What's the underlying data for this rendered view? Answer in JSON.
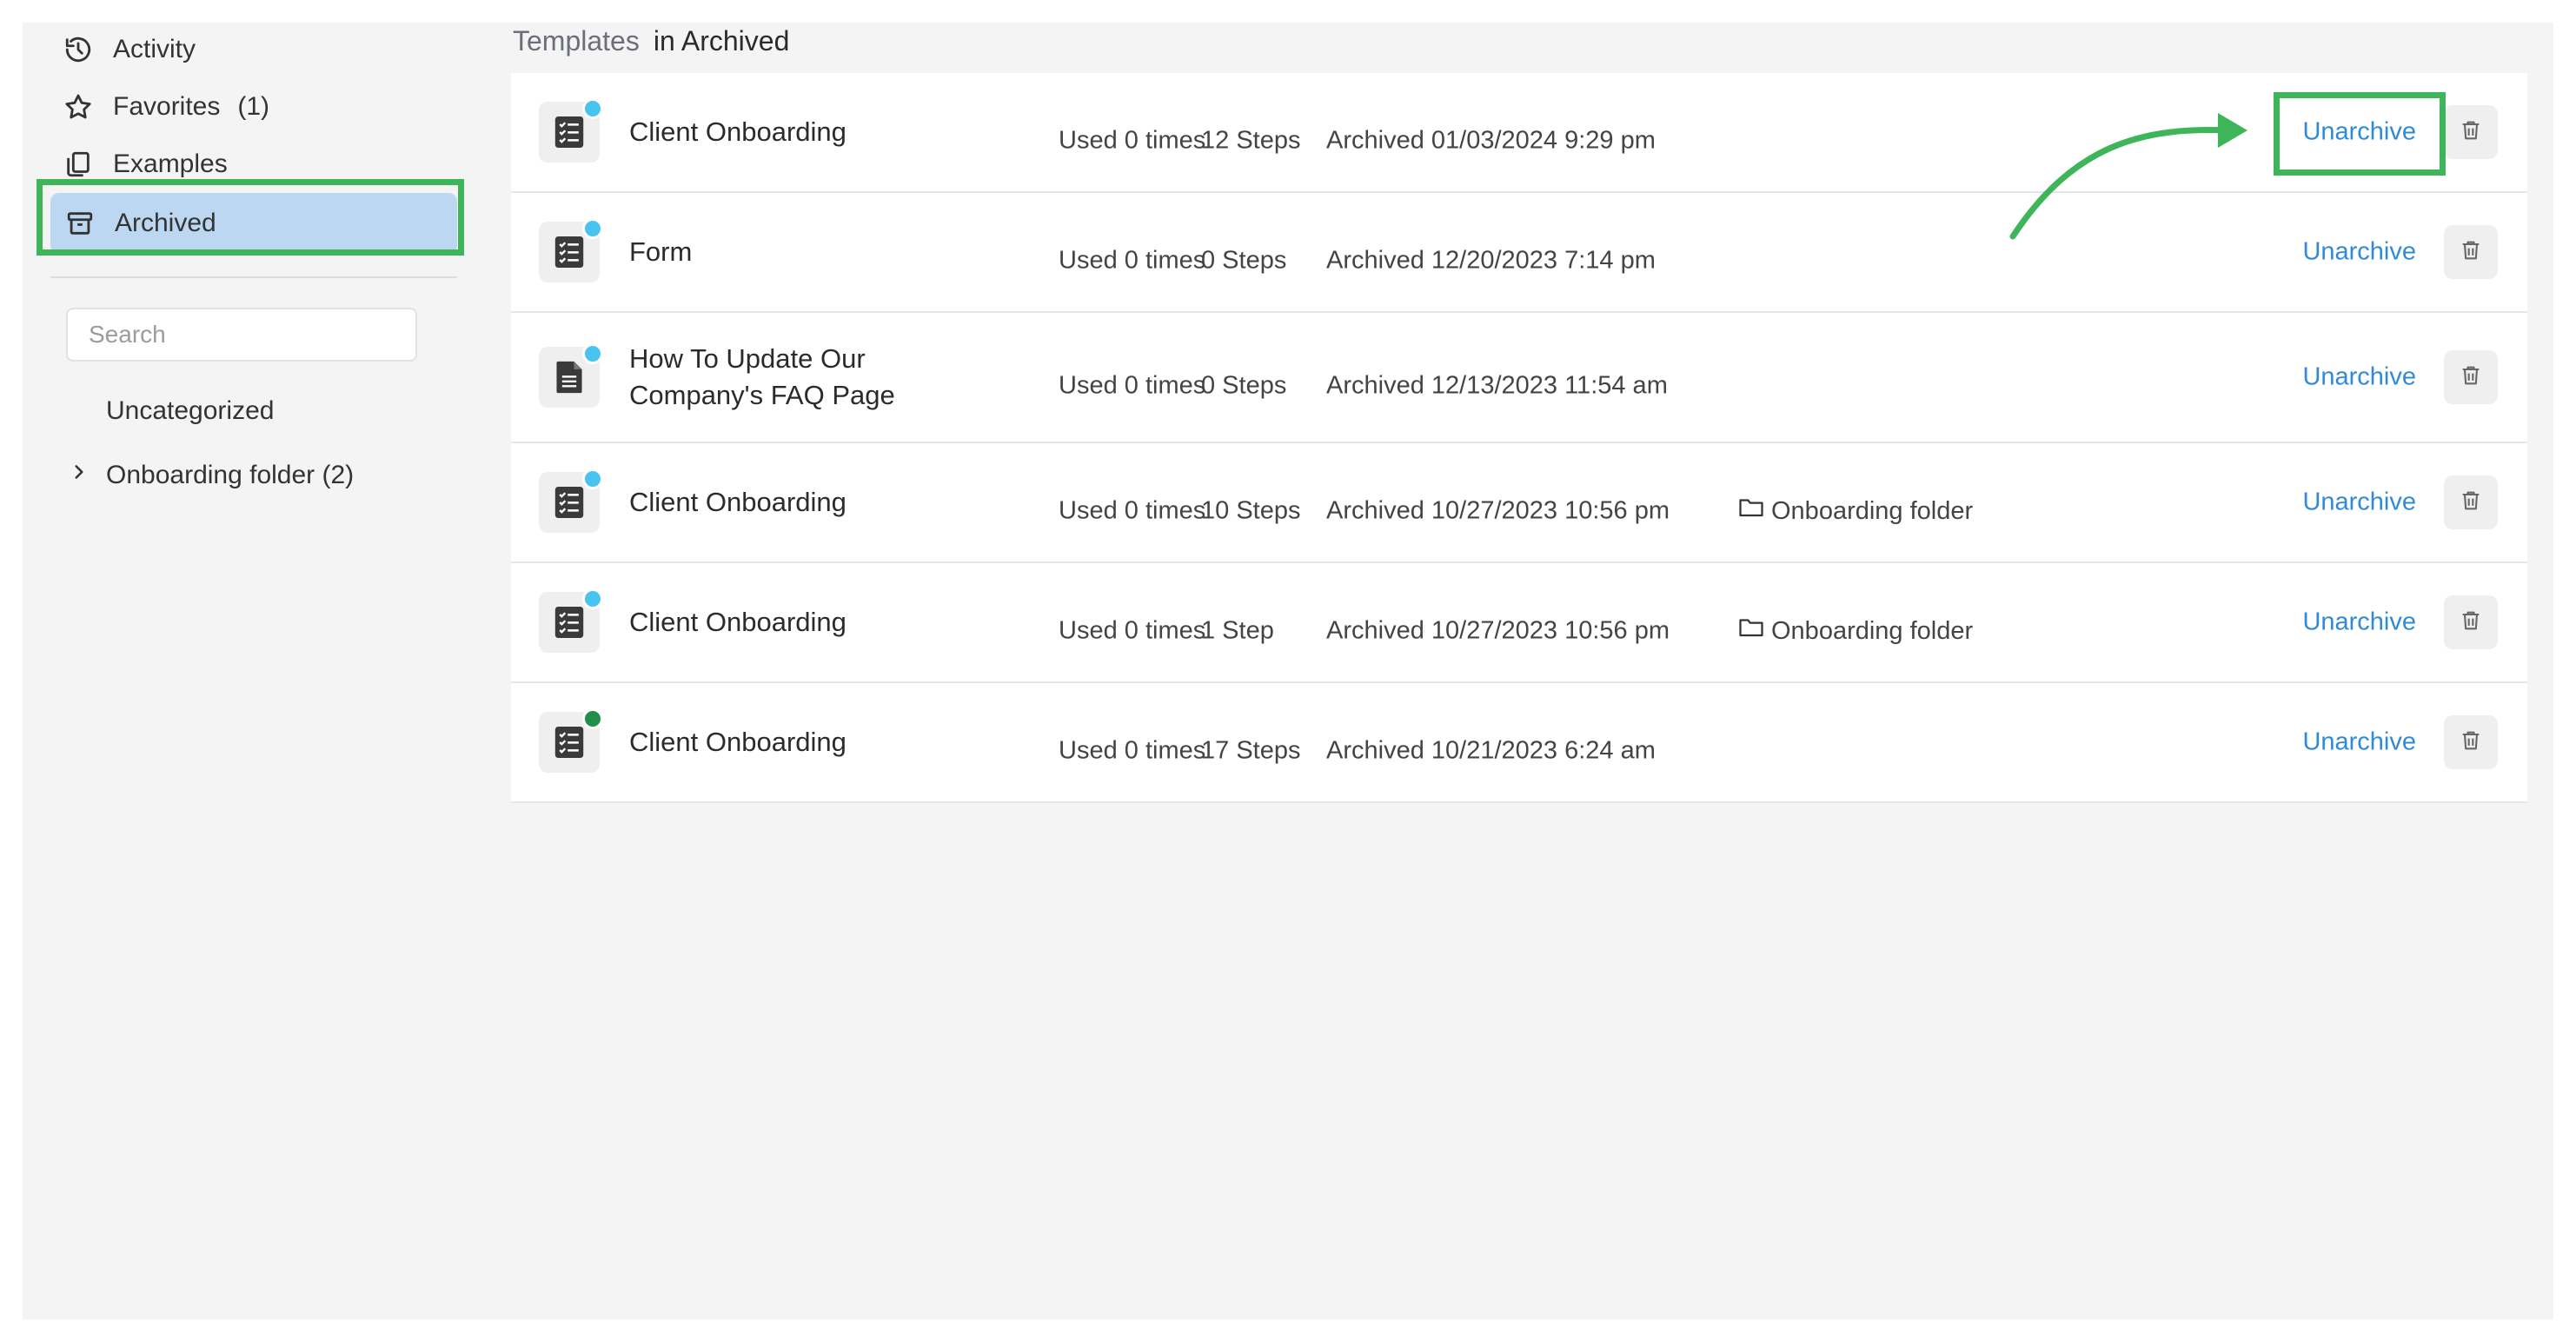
{
  "sidebar": {
    "nav": [
      {
        "label": "Activity",
        "icon": "history-icon"
      },
      {
        "label": "Favorites",
        "count": "(1)",
        "icon": "star-icon"
      },
      {
        "label": "Examples",
        "icon": "copy-icon"
      },
      {
        "label": "Archived",
        "icon": "archive-icon",
        "active": true
      }
    ],
    "search": {
      "placeholder": "Search",
      "value": ""
    },
    "folders": [
      {
        "label": "Uncategorized"
      },
      {
        "label": "Onboarding folder (2)",
        "icon": "chevron-right-icon"
      }
    ]
  },
  "breadcrumb": {
    "link": "Templates",
    "current": "in Archived"
  },
  "templates": [
    {
      "title": "Client Onboarding",
      "used": "Used 0 times",
      "steps": "12 Steps",
      "archived": "Archived 01/03/2024 9:29 pm",
      "folder": "",
      "icon": "checklist-icon",
      "dot_color": "#49c3ef",
      "action": "Unarchive"
    },
    {
      "title": "Form",
      "used": "Used 0 times",
      "steps": "0 Steps",
      "archived": "Archived 12/20/2023 7:14 pm",
      "folder": "",
      "icon": "checklist-icon",
      "dot_color": "#49c3ef",
      "action": "Unarchive"
    },
    {
      "title": "How To Update Our Company's FAQ Page",
      "used": "Used 0 times",
      "steps": "0 Steps",
      "archived": "Archived 12/13/2023 11:54 am",
      "folder": "",
      "icon": "document-icon",
      "dot_color": "#49c3ef",
      "action": "Unarchive"
    },
    {
      "title": "Client Onboarding",
      "used": "Used 0 times",
      "steps": "10 Steps",
      "archived": "Archived 10/27/2023 10:56 pm",
      "folder": "Onboarding folder",
      "icon": "checklist-icon",
      "dot_color": "#49c3ef",
      "action": "Unarchive"
    },
    {
      "title": "Client Onboarding",
      "used": "Used 0 times",
      "steps": "1 Step",
      "archived": "Archived 10/27/2023 10:56 pm",
      "folder": "Onboarding folder",
      "icon": "checklist-icon",
      "dot_color": "#49c3ef",
      "action": "Unarchive"
    },
    {
      "title": "Client Onboarding",
      "used": "Used 0 times",
      "steps": "17 Steps",
      "archived": "Archived 10/21/2023 6:24 am",
      "folder": "",
      "icon": "checklist-icon",
      "dot_color": "#1f8f4a",
      "action": "Unarchive"
    }
  ],
  "colors": {
    "highlight": "#3fb55a",
    "link": "#2f8ad8",
    "active_bg": "#bcd7f1"
  }
}
